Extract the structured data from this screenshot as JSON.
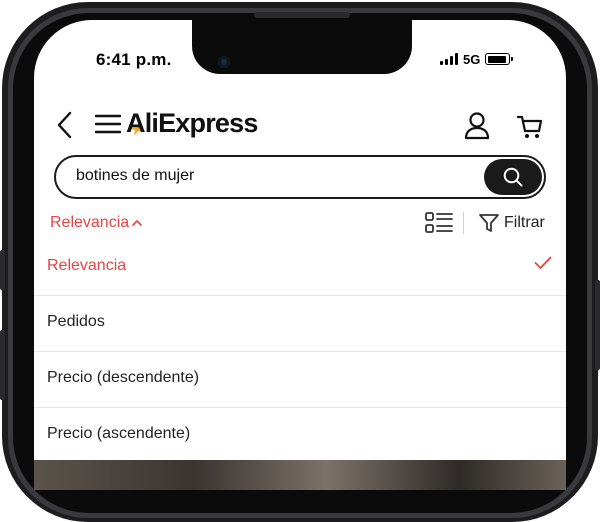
{
  "status_bar": {
    "time": "6:41 p.m.",
    "network": "5G",
    "battery_level": 0.9
  },
  "header": {
    "logo": "AliExpress",
    "back_icon": "chevron-left-icon",
    "menu_icon": "hamburger-menu-icon",
    "account_icon": "user-icon",
    "cart_icon": "cart-icon"
  },
  "search": {
    "value": "botines de mujer",
    "button_icon": "search-icon"
  },
  "sort_bar": {
    "active_sort": "Relevancia",
    "view_icon": "list-view-icon",
    "filter_label": "Filtrar",
    "filter_icon": "funnel-icon"
  },
  "sort_options": [
    {
      "label": "Relevancia",
      "selected": true
    },
    {
      "label": "Pedidos",
      "selected": false
    },
    {
      "label": "Precio (descendente)",
      "selected": false
    },
    {
      "label": "Precio (ascendente)",
      "selected": false
    }
  ],
  "colors": {
    "accent": "#e64545",
    "text": "#222222",
    "frame": "#1d1d1f",
    "logo_star": "#f2a72c"
  }
}
